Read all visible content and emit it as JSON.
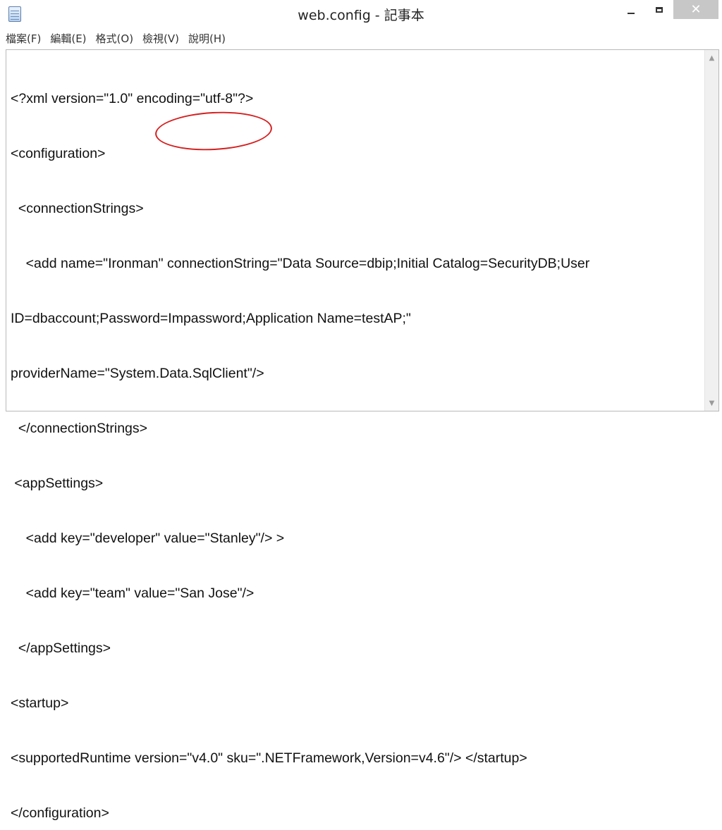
{
  "window": {
    "title": "web.config - 記事本",
    "close_symbol": "✕"
  },
  "menu": [
    "檔案(F)",
    "編輯(E)",
    "格式(O)",
    "檢視(V)",
    "說明(H)"
  ],
  "editor": {
    "lines": [
      "<?xml version=\"1.0\" encoding=\"utf-8\"?>",
      "<configuration>",
      "  <connectionStrings>",
      "    <add name=\"Ironman\" connectionString=\"Data Source=dbip;Initial Catalog=SecurityDB;User",
      "ID=dbaccount;Password=Impassword;Application Name=testAP;\"",
      "providerName=\"System.Data.SqlClient\"/>",
      "  </connectionStrings>",
      " <appSettings>",
      "    <add key=\"developer\" value=\"Stanley\"/> >",
      "    <add key=\"team\" value=\"San Jose\"/>",
      "  </appSettings>",
      "<startup>",
      "<supportedRuntime version=\"v4.0\" sku=\".NETFramework,Version=v4.6\"/> </startup>",
      "</configuration>"
    ]
  },
  "annotation": {
    "color": "#d42020"
  },
  "icons": {
    "app": "notepad-icon",
    "scroll_up": "▲",
    "scroll_down": "▼"
  }
}
